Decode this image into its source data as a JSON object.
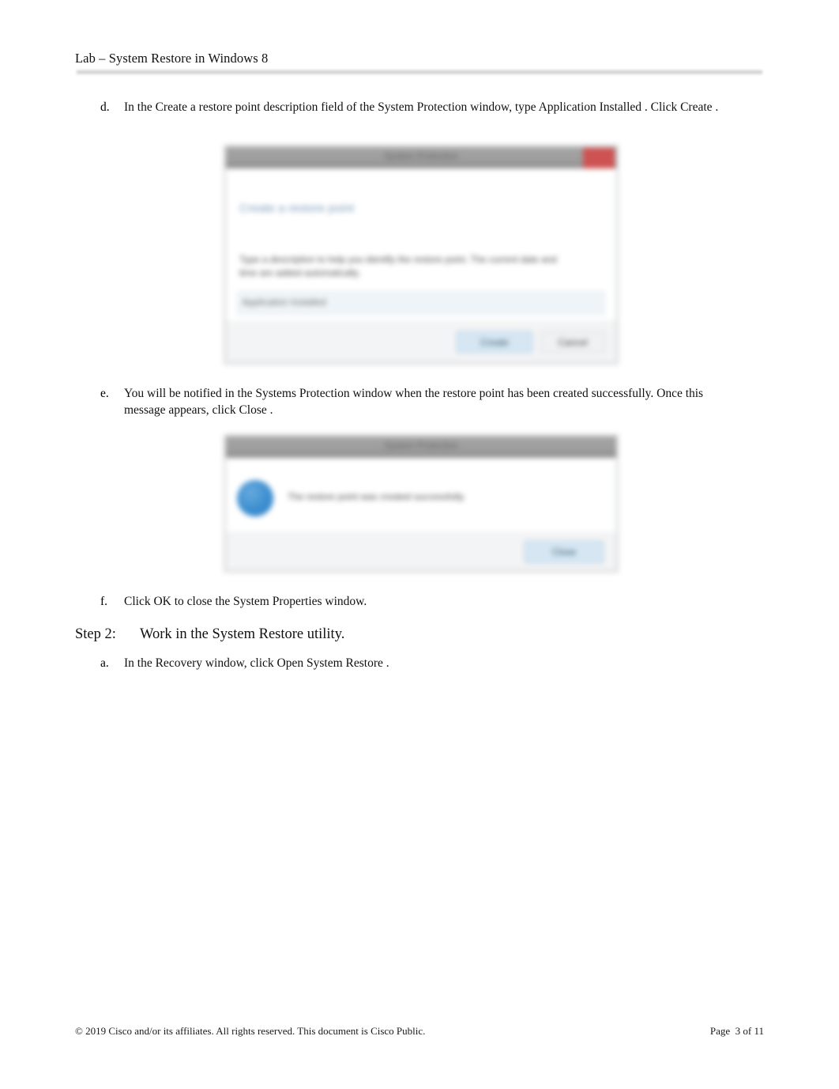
{
  "header": {
    "title": "Lab – System Restore in Windows 8"
  },
  "steps": [
    {
      "marker": "d.",
      "text": "In the  Create a restore point       description field of the   System Protection       window, type   Application Installed   . Click Create  ."
    },
    {
      "marker": "e.",
      "text": "You will be notified in the   Systems Protection       window when the restore point has been created successfully. Once this message appears, click         Close  ."
    },
    {
      "marker": "f.",
      "text": "Click  OK  to close the   System Properties       window."
    },
    {
      "marker": "a.",
      "text": "In the  Recovery     window, click  Open System Restore      ."
    }
  ],
  "step_heading": {
    "label": "Step 2:",
    "title": "Work in the System Restore utility."
  },
  "figures": [
    {
      "name": "system-protection-create-restore-point",
      "title": "System Protection",
      "heading": "Create a restore point",
      "body_line_1": "Type a description to help you identify the restore point. The current date and",
      "body_line_2": "time are added automatically.",
      "input_value": "Application Installed",
      "buttons": [
        {
          "label": "Create",
          "focused": true
        },
        {
          "label": "Cancel",
          "focused": false
        }
      ],
      "close_button": "close-button",
      "close_button_color": "#cf5252"
    },
    {
      "name": "system-protection-confirmation",
      "title": "System Protection",
      "message": "The restore point was created successfully.",
      "icon": "info-icon",
      "icon_color": "#3b8ed0",
      "buttons": [
        {
          "label": "Close",
          "focused": true
        }
      ]
    }
  ],
  "footer": {
    "copyright": "© 2019 Cisco and/or its affiliates. All rights reserved. This document is Cisco Public.",
    "page_label": "Page",
    "page_value": "3 of 11"
  }
}
